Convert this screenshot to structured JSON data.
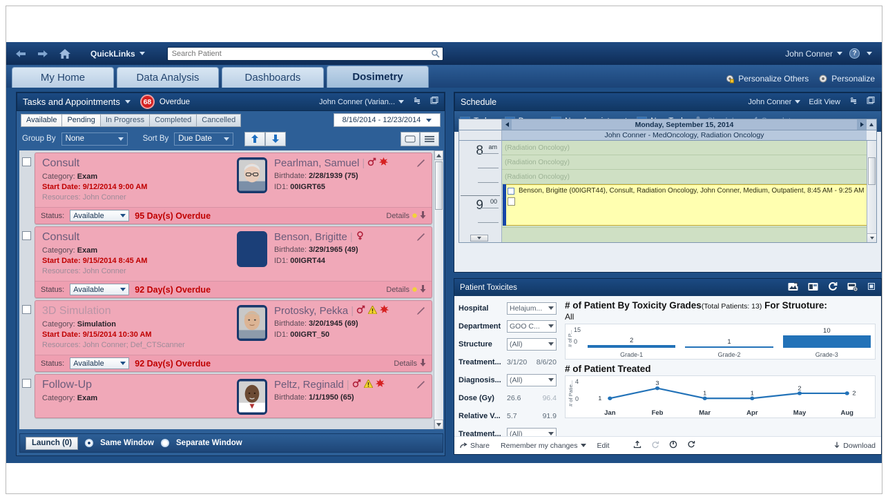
{
  "globalbar": {
    "back_icon": "arrow-left-icon",
    "forward_icon": "arrow-right-icon",
    "home_icon": "home-icon",
    "quicklinks_label": "QuickLinks",
    "search_placeholder": "Search Patient",
    "search_value": "",
    "user_label": "John Conner",
    "help_label": "?"
  },
  "tabs": [
    {
      "label": "My Home",
      "active": false
    },
    {
      "label": "Data Analysis",
      "active": false
    },
    {
      "label": "Dashboards",
      "active": false
    },
    {
      "label": "Dosimetry",
      "active": true
    }
  ],
  "tabstrip_actions": [
    {
      "label": "Personalize Others",
      "icon": "gear-lock-icon"
    },
    {
      "label": "Personalize",
      "icon": "gear-icon"
    }
  ],
  "tasks_panel": {
    "title": "Tasks and Appointments",
    "overdue_count": "68",
    "overdue_label": "Overdue",
    "owner": "John Conner (Varian...",
    "refresh_icon": "refresh-icon",
    "popout_icon": "popout-icon",
    "filters": [
      {
        "label": "Available",
        "state": "selected"
      },
      {
        "label": "Pending",
        "state": "selected"
      },
      {
        "label": "In Progress",
        "state": "dim"
      },
      {
        "label": "Completed",
        "state": "dim"
      },
      {
        "label": "Cancelled",
        "state": "dim"
      }
    ],
    "date_range": "8/16/2014 - 12/23/2014",
    "group_by_label": "Group By",
    "group_by_value": "None",
    "sort_by_label": "Sort By",
    "sort_by_value": "Due Date",
    "sort_asc_icon": "arrow-up-icon",
    "sort_desc_icon": "arrow-down-icon",
    "view_card_icon": "card-view-icon",
    "view_list_icon": "list-view-icon",
    "cards": [
      {
        "type": "Consult",
        "type_dim": false,
        "category_label": "Category:",
        "category": "Exam",
        "start_label": "Start Date:",
        "start": "9/12/2014 9:00 AM",
        "resources_label": "Resources:",
        "resources": "John Conner",
        "patient": "Pearlman, Samuel",
        "gender": "male",
        "flags": [
          "allergy"
        ],
        "birth_label": "Birthdate:",
        "birth": "2/28/1939",
        "age": "(75)",
        "id_label": "ID1:",
        "id": "00IGRT65",
        "status_label": "Status:",
        "status": "Available",
        "overdue": "95 Day(s) Overdue",
        "details_label": "Details",
        "has_photo": true,
        "photo_tone": "light"
      },
      {
        "type": "Consult",
        "type_dim": false,
        "category_label": "Category:",
        "category": "Exam",
        "start_label": "Start Date:",
        "start": "9/15/2014 8:45 AM",
        "resources_label": "Resources:",
        "resources": "John Conner",
        "patient": "Benson, Brigitte",
        "gender": "female",
        "flags": [],
        "birth_label": "Birthdate:",
        "birth": "3/29/1965",
        "age": "(49)",
        "id_label": "ID1:",
        "id": "00IGRT44",
        "status_label": "Status:",
        "status": "Available",
        "overdue": "92 Day(s) Overdue",
        "details_label": "Details",
        "has_photo": false,
        "photo_tone": "none"
      },
      {
        "type": "3D Simulation",
        "type_dim": true,
        "category_label": "Category:",
        "category": "Simulation",
        "start_label": "Start Date:",
        "start": "9/15/2014 10:30 AM",
        "resources_label": "Resources:",
        "resources": "John Conner; Def_CTScanner",
        "patient": "Protosky, Pekka",
        "gender": "male",
        "flags": [
          "warning",
          "allergy"
        ],
        "birth_label": "Birthdate:",
        "birth": "3/20/1945",
        "age": "(69)",
        "id_label": "ID1:",
        "id": "00IGRT_50",
        "status_label": "Status:",
        "status": "Available",
        "overdue": "92 Day(s) Overdue",
        "details_label": "Details",
        "has_photo": true,
        "photo_tone": "tan"
      },
      {
        "type": "Follow-Up",
        "type_dim": false,
        "category_label": "Category:",
        "category": "Exam",
        "start_label": "",
        "start": "",
        "resources_label": "",
        "resources": "",
        "patient": "Peltz, Reginald",
        "gender": "male",
        "flags": [
          "warning",
          "allergy"
        ],
        "birth_label": "Birthdate:",
        "birth": "1/1/1950",
        "age": "(65)",
        "id_label": "",
        "id": "",
        "status_label": "",
        "status": "",
        "overdue": "",
        "details_label": "",
        "has_photo": true,
        "photo_tone": "dark"
      }
    ],
    "launch_label": "Launch (0)",
    "same_window_label": "Same Window",
    "separate_window_label": "Separate Window",
    "window_mode": "same"
  },
  "schedule": {
    "title": "Schedule",
    "owner": "John Conner",
    "edit_view_label": "Edit View",
    "refresh_icon": "refresh-icon",
    "popout_icon": "popout-icon",
    "toolbar": [
      {
        "label": "Today",
        "icon": "calendar-today-icon",
        "disabled": false
      },
      {
        "label": "Day",
        "icon": "calendar-day-icon",
        "disabled": false,
        "dropdown": true
      },
      {
        "label": "New Appointment",
        "icon": "calendar-add-icon",
        "disabled": false
      },
      {
        "label": "New Task",
        "icon": "task-add-icon",
        "disabled": false
      },
      {
        "label": "Check In",
        "icon": "check-in-icon",
        "disabled": true
      },
      {
        "label": "Complete",
        "icon": "check-icon",
        "disabled": true
      }
    ],
    "date_header": "Monday, September 15, 2014",
    "resource_header": "John Conner - MedOncology, Radiation Oncology",
    "hours": [
      {
        "hour": "8",
        "suffix": "am"
      },
      {
        "hour": "9",
        "suffix": "00"
      }
    ],
    "slot_label": "(Radiation Oncology)",
    "slots": 5,
    "appointment": "Benson, Brigitte (00IGRT44), Consult, Radiation Oncology, John Conner, Medium, Outpatient, 8:45 AM - 9:25 AM"
  },
  "toxicity": {
    "title": "Patient Toxicites",
    "header_icons": [
      "export-image-icon",
      "filter-icon",
      "refresh-icon",
      "snapshot-add-icon",
      "maximize-icon"
    ],
    "filters": [
      {
        "label": "Hospital",
        "kind": "select",
        "value": "Helajum..."
      },
      {
        "label": "Department",
        "kind": "select",
        "value": "GOO C..."
      },
      {
        "label": "Structure",
        "kind": "select",
        "value": "(All)"
      },
      {
        "label": "Treatment...",
        "kind": "range",
        "min": "3/1/20",
        "max": "8/6/20"
      },
      {
        "label": "Diagnosis...",
        "kind": "select",
        "value": "(All)"
      },
      {
        "label": "Dose (Gy)",
        "kind": "range",
        "min": "26.6",
        "max": "96.4"
      },
      {
        "label": "Relative V...",
        "kind": "range",
        "min": "5.7",
        "max": "91.9"
      },
      {
        "label": "Treatment...",
        "kind": "select",
        "value": "(All)"
      }
    ],
    "footer": {
      "share_label": "Share",
      "remember_label": "Remember my changes",
      "edit_label": "Edit",
      "download_label": "Download",
      "icons": [
        "upload-icon",
        "undo-icon",
        "power-icon",
        "refresh-icon"
      ]
    }
  },
  "chart_data": [
    {
      "type": "bar",
      "title": "# of Patient By Toxicity Grades",
      "title_sub": "(Total Patients: 13)",
      "title_tail": " For Struoture:",
      "subtitle": "All",
      "categories": [
        "Grade-1",
        "Grade-2",
        "Grade-3"
      ],
      "values": [
        2,
        1,
        10
      ],
      "ylabel": "# of P...",
      "yticks": [
        "15",
        "0"
      ],
      "ylim": [
        0,
        15
      ],
      "xlabel": "",
      "grid": false,
      "legend": "none",
      "color": "#2272b8"
    },
    {
      "type": "line",
      "title": "# of Patient Treated",
      "categories": [
        "Jan",
        "Feb",
        "Mar",
        "Apr",
        "May",
        "Aug"
      ],
      "values": [
        1,
        3,
        1,
        1,
        2,
        2
      ],
      "ylabel": "# of Patie...",
      "yticks": [
        "4",
        "0"
      ],
      "ylim": [
        0,
        4
      ],
      "xlabel": "",
      "grid": false,
      "legend": "none",
      "color": "#2272b8"
    }
  ]
}
